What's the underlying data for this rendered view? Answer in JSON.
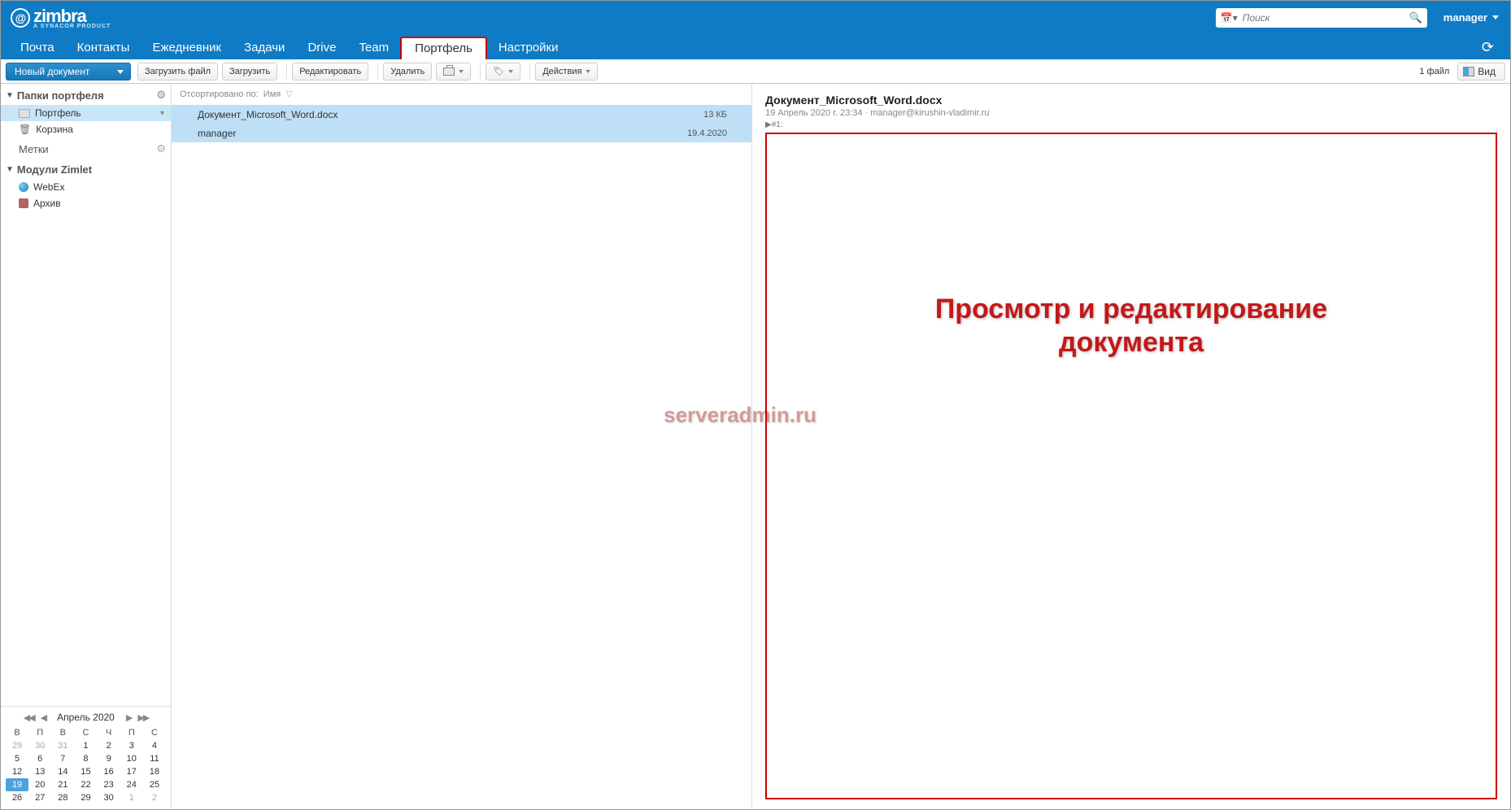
{
  "header": {
    "logo_text": "zimbra",
    "logo_sub": "A SYNACOR PRODUCT",
    "search_placeholder": "Поиск",
    "user_label": "manager"
  },
  "tabs": [
    "Почта",
    "Контакты",
    "Ежедневник",
    "Задачи",
    "Drive",
    "Team",
    "Портфель",
    "Настройки"
  ],
  "active_tab_index": 6,
  "toolbar": {
    "new_doc": "Новый документ",
    "upload_file": "Загрузить файл",
    "upload": "Загрузить",
    "edit": "Редактировать",
    "delete": "Удалить",
    "actions": "Действия",
    "file_count": "1 файл",
    "view": "Вид"
  },
  "sidebar": {
    "folders_header": "Папки портфеля",
    "items": [
      {
        "label": "Портфель",
        "selected": true
      },
      {
        "label": "Корзина",
        "selected": false
      }
    ],
    "tags_header": "Метки",
    "zimlets_header": "Модули Zimlet",
    "zimlets": [
      {
        "label": "WebEx"
      },
      {
        "label": "Архив"
      }
    ]
  },
  "sort": {
    "label_prefix": "Отсортировано по:",
    "field": "Имя"
  },
  "files": [
    {
      "name": "Документ_Microsoft_Word.docx",
      "author": "manager",
      "size": "13 КБ",
      "date": "19.4.2020"
    }
  ],
  "preview": {
    "title": "Документ_Microsoft_Word.docx",
    "meta": "19 Апрель 2020 г. 23:34 · manager@kirushin-vladimir.ru",
    "nav": "▶#1:",
    "overlay_line1": "Просмотр и редактирование",
    "overlay_line2": "документа",
    "watermark": "serveradmin.ru"
  },
  "calendar": {
    "title": "Апрель 2020",
    "dow": [
      "В",
      "П",
      "В",
      "С",
      "Ч",
      "П",
      "С"
    ],
    "weeks": [
      [
        {
          "d": "29",
          "o": true
        },
        {
          "d": "30",
          "o": true
        },
        {
          "d": "31",
          "o": true
        },
        {
          "d": "1"
        },
        {
          "d": "2"
        },
        {
          "d": "3"
        },
        {
          "d": "4"
        }
      ],
      [
        {
          "d": "5"
        },
        {
          "d": "6"
        },
        {
          "d": "7"
        },
        {
          "d": "8"
        },
        {
          "d": "9"
        },
        {
          "d": "10"
        },
        {
          "d": "11"
        }
      ],
      [
        {
          "d": "12"
        },
        {
          "d": "13"
        },
        {
          "d": "14"
        },
        {
          "d": "15"
        },
        {
          "d": "16"
        },
        {
          "d": "17"
        },
        {
          "d": "18"
        }
      ],
      [
        {
          "d": "19",
          "t": true
        },
        {
          "d": "20"
        },
        {
          "d": "21"
        },
        {
          "d": "22"
        },
        {
          "d": "23"
        },
        {
          "d": "24"
        },
        {
          "d": "25"
        }
      ],
      [
        {
          "d": "26"
        },
        {
          "d": "27"
        },
        {
          "d": "28"
        },
        {
          "d": "29"
        },
        {
          "d": "30"
        },
        {
          "d": "1",
          "o": true
        },
        {
          "d": "2",
          "o": true
        }
      ]
    ]
  }
}
